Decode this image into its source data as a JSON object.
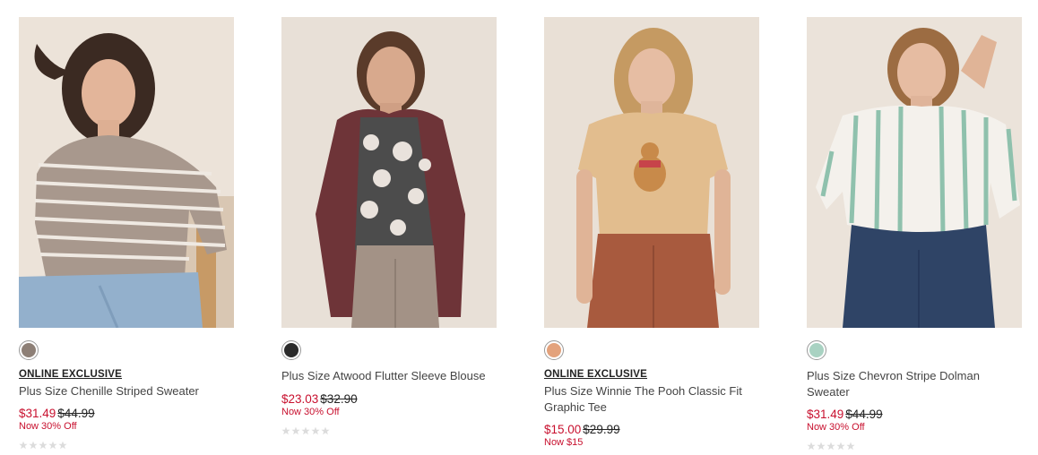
{
  "products": [
    {
      "badge": "ONLINE EXCLUSIVE",
      "title": "Plus Size Chenille Striped Sweater",
      "sale_price": "$31.49",
      "original_price": "$44.99",
      "promo": "Now 30% Off",
      "swatch_color": "#8d7f76",
      "rating_stars": 0,
      "image_alt": "Woman in taupe striped chenille sweater and jeans"
    },
    {
      "badge": "",
      "title": "Plus Size Atwood Flutter Sleeve Blouse",
      "sale_price": "$23.03",
      "original_price": "$32.90",
      "promo": "Now 30% Off",
      "swatch_color": "#2b2b2b",
      "rating_stars": 0,
      "image_alt": "Woman in floral blouse with burgundy blazer"
    },
    {
      "badge": "ONLINE EXCLUSIVE",
      "title": "Plus Size Winnie The Pooh Classic Fit Graphic Tee",
      "sale_price": "$15.00",
      "original_price": "$29.99",
      "promo": "Now $15",
      "swatch_color": "#e3a27c",
      "rating_stars": 0,
      "image_alt": "Woman in tan Winnie the Pooh graphic tee"
    },
    {
      "badge": "",
      "title": "Plus Size Chevron Stripe Dolman Sweater",
      "sale_price": "$31.49",
      "original_price": "$44.99",
      "promo": "Now 30% Off",
      "swatch_color": "#a9d2c2",
      "rating_stars": 0,
      "image_alt": "Woman in white and green chevron stripe sweater"
    }
  ],
  "colors": {
    "sale_red": "#c8102e",
    "photo_bg": "#e9e0d6",
    "star_empty": "#dcdcdc"
  }
}
